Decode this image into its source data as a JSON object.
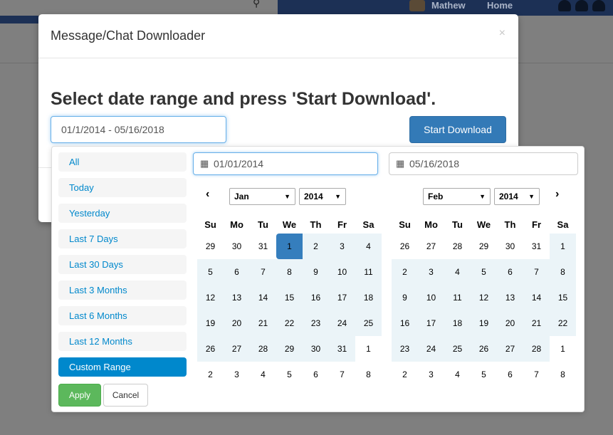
{
  "topbar": {
    "user": "Mathew",
    "home": "Home"
  },
  "modal": {
    "title": "Message/Chat Downloader",
    "close": "×",
    "heading": "Select date range and press 'Start Download'.",
    "range_value": "01/1/2014 - 05/16/2018",
    "start_button": "Start Download"
  },
  "picker": {
    "ranges": [
      "All",
      "Today",
      "Yesterday",
      "Last 7 Days",
      "Last 30 Days",
      "Last 3 Months",
      "Last 6 Months",
      "Last 12 Months",
      "Custom Range"
    ],
    "active_range": "Custom Range",
    "start_input": "01/01/2014",
    "end_input": "05/16/2018",
    "apply": "Apply",
    "cancel": "Cancel",
    "weekdays": [
      "Su",
      "Mo",
      "Tu",
      "We",
      "Th",
      "Fr",
      "Sa"
    ],
    "left": {
      "month": "Jan",
      "year": "2014",
      "prev": "‹",
      "weeks": [
        [
          "29",
          "30",
          "31",
          "1",
          "2",
          "3",
          "4"
        ],
        [
          "5",
          "6",
          "7",
          "8",
          "9",
          "10",
          "11"
        ],
        [
          "12",
          "13",
          "14",
          "15",
          "16",
          "17",
          "18"
        ],
        [
          "19",
          "20",
          "21",
          "22",
          "23",
          "24",
          "25"
        ],
        [
          "26",
          "27",
          "28",
          "29",
          "30",
          "31",
          "1"
        ],
        [
          "2",
          "3",
          "4",
          "5",
          "6",
          "7",
          "8"
        ]
      ]
    },
    "right": {
      "month": "Feb",
      "year": "2014",
      "next": "›",
      "weeks": [
        [
          "26",
          "27",
          "28",
          "29",
          "30",
          "31",
          "1"
        ],
        [
          "2",
          "3",
          "4",
          "5",
          "6",
          "7",
          "8"
        ],
        [
          "9",
          "10",
          "11",
          "12",
          "13",
          "14",
          "15"
        ],
        [
          "16",
          "17",
          "18",
          "19",
          "20",
          "21",
          "22"
        ],
        [
          "23",
          "24",
          "25",
          "26",
          "27",
          "28",
          "1"
        ],
        [
          "2",
          "3",
          "4",
          "5",
          "6",
          "7",
          "8"
        ]
      ]
    },
    "colors": {
      "accent": "#357ebd",
      "range_bg": "#ebf4f8",
      "apply_green": "#5cb85c",
      "link": "#0088cc"
    }
  }
}
